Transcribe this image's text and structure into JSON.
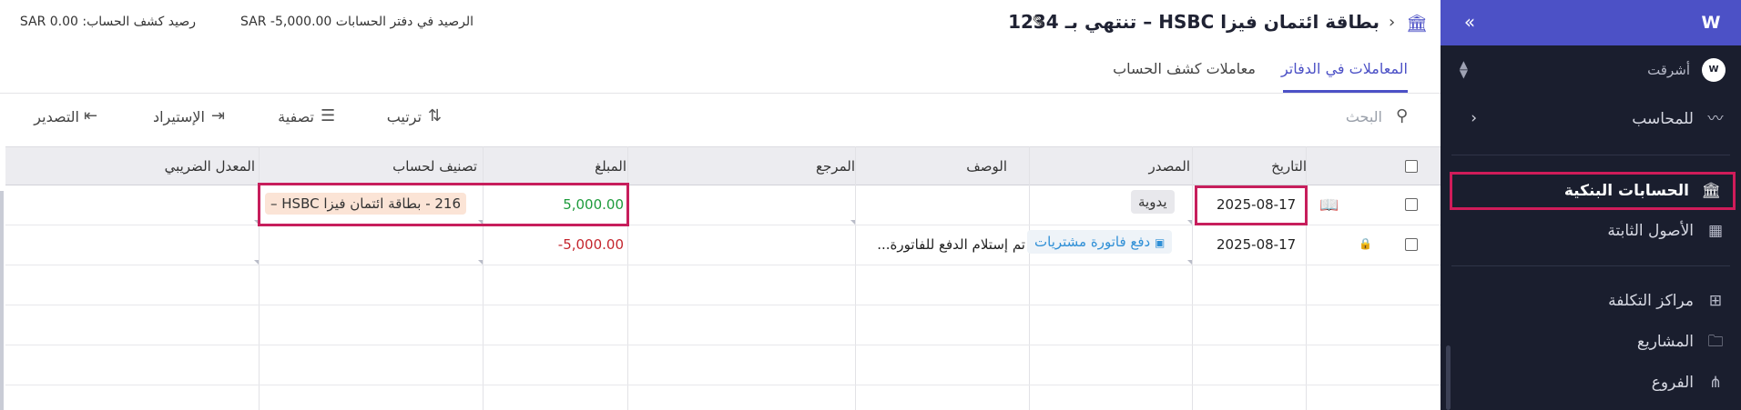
{
  "sidebar": {
    "logo": "W",
    "collapse_icon": "«",
    "org": {
      "avatar": "W",
      "name": "أشرقت"
    },
    "accountant_item": "للمحاسب",
    "items": [
      {
        "label": "الحسابات البنكية",
        "icon": "bank-icon",
        "active": true
      },
      {
        "label": "الأصول الثابتة",
        "icon": "building-icon"
      },
      {
        "label": "مراكز التكلفة",
        "icon": "grid-plus-icon"
      },
      {
        "label": "المشاريع",
        "icon": "folder-icon"
      },
      {
        "label": "الفروع",
        "icon": "branches-icon"
      }
    ]
  },
  "header": {
    "title": "بطاقة ائتمان فيزا HSBC – تنتهي بـ 1234",
    "ledger_balance": "الرصيد في دفتر الحسابات SAR -5,000.00",
    "statement_balance": "رصيد كشف الحساب: SAR 0.00"
  },
  "tabs": [
    {
      "label": "المعاملات في الدفاتر",
      "active": true
    },
    {
      "label": "معاملات كشف الحساب",
      "active": false
    }
  ],
  "toolbar": {
    "search_placeholder": "البحث",
    "sort": "ترتيب",
    "filter": "تصفية",
    "import": "الإستيراد",
    "export": "التصدير"
  },
  "table": {
    "columns": [
      "التاريخ",
      "المصدر",
      "الوصف",
      "المرجع",
      "المبلغ",
      "تصنيف لحساب",
      "المعدل الضريبي"
    ],
    "rows": [
      {
        "date": "2025-08-17",
        "source": "يدوية",
        "description": "",
        "reference": "",
        "amount": "5,000.00",
        "category": "216 - بطاقة ائتمان فيزا HSBC –",
        "tax_rate": ""
      },
      {
        "date": "2025-08-17",
        "source": "دفع فاتورة مشتريات",
        "description": "تم إستلام الدفع للفاتورة...",
        "reference": "",
        "amount": "-5,000.00",
        "category": "",
        "tax_rate": ""
      }
    ]
  },
  "colors": {
    "brand": "#4c51c6",
    "sidebar_bg": "#1a1e2e",
    "highlight": "#c71e5c",
    "positive": "#1e9b3c",
    "negative": "#c4262e",
    "link": "#2f8fd6"
  }
}
